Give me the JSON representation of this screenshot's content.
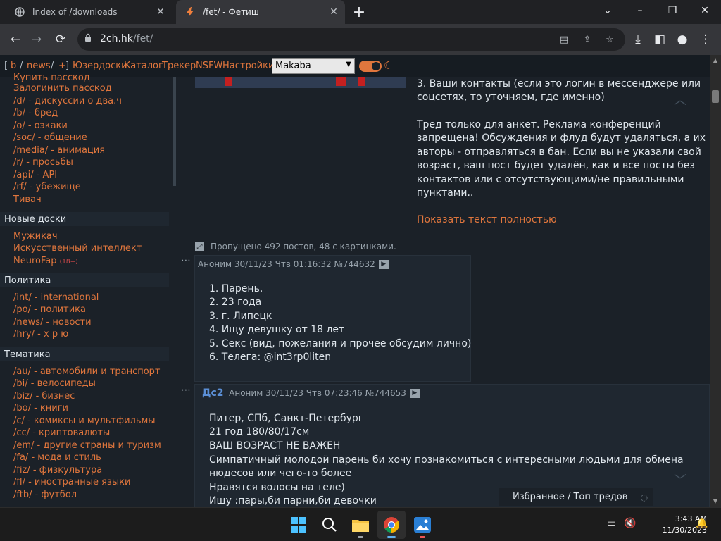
{
  "browser": {
    "tabs": [
      {
        "title": "Index of /downloads",
        "icon": "globe-icon",
        "active": false
      },
      {
        "title": "/fet/ - Фетиш",
        "icon": "lightning-icon",
        "active": true
      }
    ],
    "new_tab": "+",
    "window_controls": [
      "⌄",
      "–",
      "❐",
      "✕"
    ],
    "url_host": "2ch.hk",
    "url_path": "/fet/"
  },
  "topnav": {
    "bracket_open": "[",
    "b": "b",
    "sep1": "/",
    "news": "news",
    "sep2": "/",
    "plus": "+",
    "bracket_close": "]",
    "links": [
      "Юзердоски",
      "Каталог",
      "Трекер",
      "NSFW",
      "Настройки"
    ],
    "style_value": "Makaba"
  },
  "sidebar": {
    "items_top": [
      {
        "code": "Купить пасскод",
        "desc": ""
      },
      {
        "code": "Залогинить пасскод",
        "desc": ""
      },
      {
        "code": "/d/",
        "desc": " - дискуссии о два.ч"
      },
      {
        "code": "/b/",
        "desc": " - бред"
      },
      {
        "code": "/o/",
        "desc": " - оэкаки"
      },
      {
        "code": "/soc/",
        "desc": " - общение"
      },
      {
        "code": "/media/",
        "desc": " - анимация"
      },
      {
        "code": "/r/",
        "desc": " - просьбы"
      },
      {
        "code": "/api/",
        "desc": " - API"
      },
      {
        "code": "/rf/",
        "desc": " - убежище"
      },
      {
        "code": "Тивач",
        "desc": ""
      }
    ],
    "section_new": "Новые доски",
    "items_new": [
      {
        "code": "Мужикач",
        "desc": ""
      },
      {
        "code": "Искусственный интеллект",
        "desc": ""
      },
      {
        "code": "NeuroFap",
        "desc": "",
        "badge": "(18+)"
      }
    ],
    "section_politics": "Политика",
    "items_politics": [
      {
        "code": "/int/",
        "desc": " - international"
      },
      {
        "code": "/po/",
        "desc": " - политика"
      },
      {
        "code": "/news/",
        "desc": " - новости"
      },
      {
        "code": "/hry/",
        "desc": " - х р ю"
      }
    ],
    "section_themes": "Тематика",
    "items_themes": [
      {
        "code": "/au/",
        "desc": " - автомобили и транспорт"
      },
      {
        "code": "/bi/",
        "desc": " - велосипеды"
      },
      {
        "code": "/biz/",
        "desc": " - бизнес"
      },
      {
        "code": "/bo/",
        "desc": " - книги"
      },
      {
        "code": "/c/",
        "desc": " - комиксы и мультфильмы"
      },
      {
        "code": "/cc/",
        "desc": " - криптовалюты"
      },
      {
        "code": "/em/",
        "desc": " - другие страны и туризм"
      },
      {
        "code": "/fa/",
        "desc": " - мода и стиль"
      },
      {
        "code": "/fiz/",
        "desc": " - физкультура"
      },
      {
        "code": "/fl/",
        "desc": " - иностранные языки"
      },
      {
        "code": "/ftb/",
        "desc": " - футбол"
      }
    ]
  },
  "op": {
    "lines": [
      "3. Ваши контакты (если это логин в мессенджере или",
      "соцсетях, то уточняем, где именно)",
      "",
      "Тред только для анкет. Реклама конференций",
      "запрещена! Обсуждения и флуд будут удаляться, а их",
      "авторы - отправляться в бан. Если вы не указали свой",
      "возраст, ваш пост будет удалён, как и все посты без",
      "контактов или с отсутствующими/не правильными",
      "пунктами.."
    ],
    "show_full": "Показать текст полностью",
    "skipped": "Пропущено 492 постов, 48 с картинками."
  },
  "posts": [
    {
      "dots": "⋯",
      "name": "",
      "header": "Аноним 30/11/23 Чтв 01:16:32 №744632",
      "body": [
        "1. Парень.",
        "2. 23 года",
        "3. г. Липецк",
        "4. Ищу девушку от 18 лет",
        "5. Секс (вид, пожелания и прочее обсудим лично)",
        "6. Телега: @int3rp0liten"
      ]
    },
    {
      "dots": "⋯",
      "name": "Дс2",
      "header": "Аноним 30/11/23 Чтв 07:23:46 №744653",
      "body": [
        "Питер, СПб, Санкт-Петербург",
        "21 год 180/80/17см",
        "ВАШ ВОЗРАСТ НЕ ВАЖЕН",
        "Симпатичный молодой парень би хочу познакомиться с интересными людьми для обмена",
        "нюдесов или чего-то более",
        "Нравятся волосы на теле)",
        "Ищу :пары,би парни,би девочки"
      ]
    }
  ],
  "favorites_bar": "Избранное / Топ тредов",
  "taskbar": {
    "time": "3:43 AM",
    "date": "11/30/2023"
  }
}
